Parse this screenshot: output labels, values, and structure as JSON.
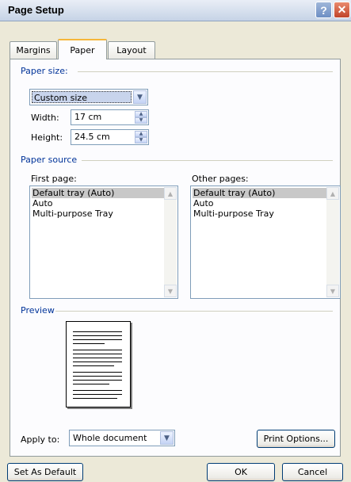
{
  "window": {
    "title": "Page Setup"
  },
  "tabs": [
    {
      "label": "Margins"
    },
    {
      "label": "Paper"
    },
    {
      "label": "Layout"
    }
  ],
  "paper_size": {
    "heading": "Paper size:",
    "selected": "Custom size",
    "width": {
      "label": "Width:",
      "value": "17 cm"
    },
    "height": {
      "label": "Height:",
      "value": "24.5 cm"
    }
  },
  "paper_source": {
    "heading": "Paper source",
    "first_page": {
      "label": "First page:",
      "items": [
        "Default tray (Auto)",
        "Auto",
        "Multi-purpose Tray"
      ]
    },
    "other_pages": {
      "label": "Other pages:",
      "items": [
        "Default tray (Auto)",
        "Auto",
        "Multi-purpose Tray"
      ]
    }
  },
  "preview": {
    "heading": "Preview"
  },
  "apply_to": {
    "label": "Apply to:",
    "selected": "Whole document"
  },
  "buttons": {
    "print_options": "Print Options...",
    "set_as_default": "Set As Default",
    "ok": "OK",
    "cancel": "Cancel"
  }
}
